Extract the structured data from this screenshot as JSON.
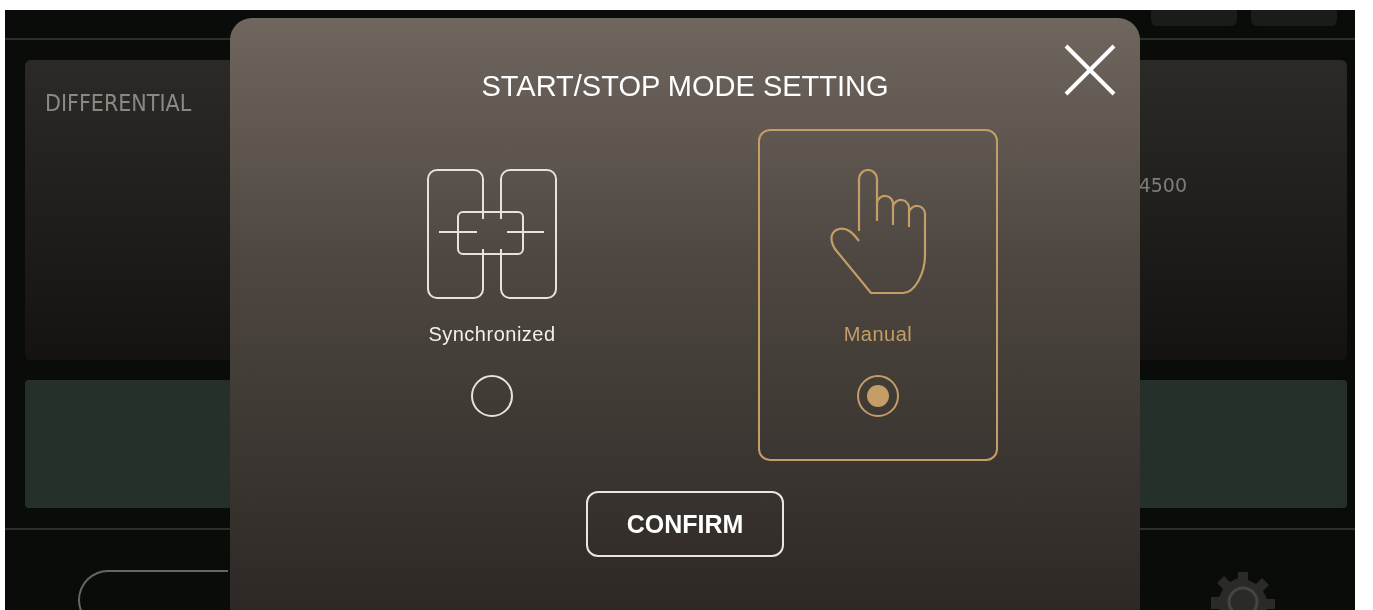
{
  "background": {
    "card_title": "DIFFERENTIAL",
    "card_value": "4500"
  },
  "dialog": {
    "title": "START/STOP MODE SETTING",
    "options": [
      {
        "label": "Synchronized",
        "kind": "synchronized",
        "selected": false
      },
      {
        "label": "Manual",
        "kind": "manual",
        "selected": true
      }
    ],
    "confirm": "CONFIRM"
  }
}
